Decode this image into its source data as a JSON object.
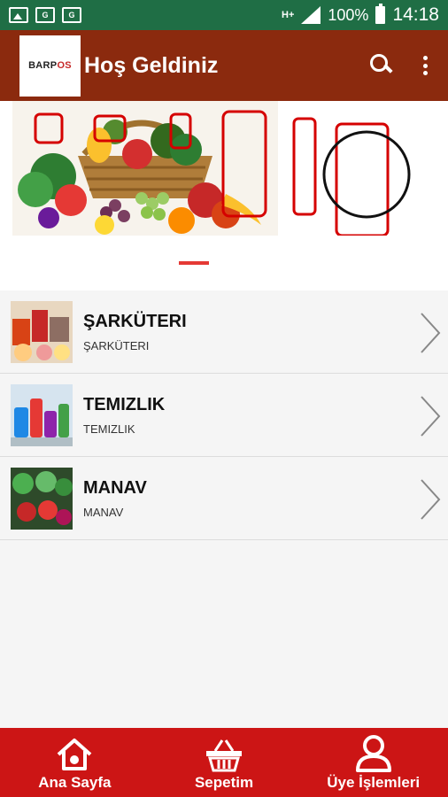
{
  "status_bar": {
    "network": "H+",
    "battery": "100%",
    "time": "14:18",
    "notification_icons": [
      "image-icon",
      "ge-icon",
      "ge-icon"
    ]
  },
  "app_bar": {
    "logo_text_a": "BARP",
    "logo_text_b": "OS",
    "title": "Hoş Geldiniz",
    "color": "#8b2a0e"
  },
  "categories": [
    {
      "title": "ŞARKÜTERI",
      "subtitle": "ŞARKÜTERI",
      "thumb": "deli-icon"
    },
    {
      "title": "TEMIZLIK",
      "subtitle": "TEMIZLIK",
      "thumb": "cleaning-icon"
    },
    {
      "title": "MANAV",
      "subtitle": "MANAV",
      "thumb": "produce-icon"
    }
  ],
  "bottom_nav": {
    "color": "#cc1515",
    "items": [
      {
        "label": "Ana Sayfa",
        "icon": "home-icon"
      },
      {
        "label": "Sepetim",
        "icon": "basket-icon"
      },
      {
        "label": "Üye İşlemleri",
        "icon": "user-icon"
      }
    ]
  }
}
